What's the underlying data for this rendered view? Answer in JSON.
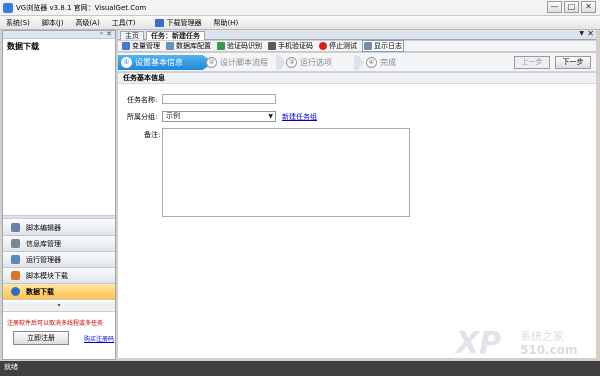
{
  "window": {
    "title": "VG浏览器 v3.8.1 官网：VisualGet.Com",
    "min": "—",
    "max": "□",
    "close": "✕"
  },
  "menu": [
    "系统(S)",
    "脚本(J)",
    "高级(A)",
    "工具(T)"
  ],
  "menu_download": "下载管理器",
  "menu_help": "帮助(H)",
  "left_panel": {
    "pin": "ᵖ",
    "close": "✕",
    "title": "数据下载",
    "nav": [
      "脚本编辑器",
      "信息库管理",
      "运行管理器",
      "脚本模块下载",
      "数据下载"
    ],
    "more": "▾",
    "notice": "注册软件后可以取消多线程或多任务",
    "register": "立即注册",
    "buy": "购买注册码"
  },
  "tabs": [
    "主页",
    "任务：新建任务"
  ],
  "tab_ctrl": {
    "pin": "▼",
    "close": "✕"
  },
  "toolbar": [
    "变量管理",
    "数据库配置",
    "验证码识别",
    "手机验证码",
    "停止测试",
    "显示日志"
  ],
  "colors": {
    "toolbar_icons": [
      "#4a78c8",
      "#6d8fb5",
      "#3b9a4a",
      "#5a5a5a",
      "#d42020",
      "#7a8aa8"
    ]
  },
  "wizard": {
    "steps": [
      {
        "num": "①",
        "label": "设置基本信息"
      },
      {
        "num": "②",
        "label": "设计脚本流程"
      },
      {
        "num": "③",
        "label": "运行选项"
      },
      {
        "num": "④",
        "label": "完成"
      }
    ],
    "prev": "上一步",
    "next": "下一步"
  },
  "section_title": "任务基本信息",
  "form": {
    "name_label": "任务名称:",
    "group_label": "所属分组:",
    "group_value": "示例",
    "group_arrow": "▼",
    "new_group": "新建任务组",
    "note_label": "备注:"
  },
  "watermark": {
    "xp": "XP",
    "cn": "系统之家",
    "num": "510.com"
  },
  "status": "就绪"
}
